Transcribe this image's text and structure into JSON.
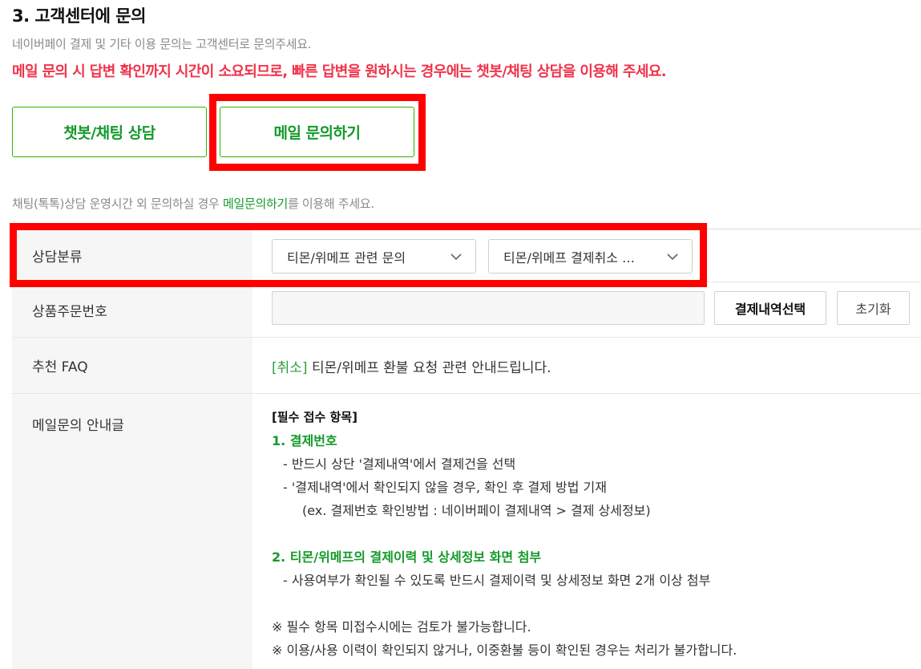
{
  "section": {
    "title": "3. 고객센터에 문의",
    "subtitle": "네이버페이 결제 및 기타 이용 문의는 고객센터로 문의주세요.",
    "warning": "메일 문의 시 답변 확인까지 시간이 소요되므로, 빠른 답변을 원하시는 경우에는 챗봇/채팅 상담을 이용해 주세요."
  },
  "buttons": {
    "chat": "챗봇/채팅 상담",
    "mail": "메일 문의하기"
  },
  "notice": {
    "before": "채팅(톡톡)상담 운영시간 외 문의하실 경우 ",
    "link": "메일문의하기",
    "after": "를 이용해 주세요."
  },
  "form": {
    "category": {
      "label": "상담분류",
      "select1": "티몬/위메프 관련 문의",
      "select2": "티몬/위메프 결제취소 …"
    },
    "order": {
      "label": "상품주문번호",
      "input_value": "",
      "select_button": "결제내역선택",
      "reset_button": "초기화"
    },
    "faq": {
      "label": "추천 FAQ",
      "tag": "[취소]",
      "text": " 티몬/위메프 환불 요청 관련 안내드립니다."
    },
    "guide": {
      "label": "메일문의 안내글",
      "heading": "[필수 접수 항목]",
      "item1_title": "1. 결제번호",
      "item1_line1": "- 반드시 상단 '결제내역'에서 결제건을 선택",
      "item1_line2": "-  '결제내역'에서 확인되지 않을 경우, 확인 후 결제 방법 기재",
      "item1_line3": "(ex. 결제번호 확인방법 : 네이버페이 결제내역 > 결제 상세정보)",
      "item2_title": "2. 티몬/위메프의 결제이력 및 상세정보 화면 첨부",
      "item2_line1": "- 사용여부가 확인될 수 있도록 반드시 결제이력 및 상세정보 화면 2개 이상 첨부",
      "note1": "※  필수 항목 미접수시에는 검토가 불가능합니다.",
      "note2": "※  이용/사용 이력이 확인되지 않거나, 이중환불 등이 확인된 경우는 처리가 불가합니다."
    }
  },
  "colors": {
    "accent_green": "#139a2a",
    "warning_red": "#f0334a",
    "highlight_red": "#ff0000"
  }
}
